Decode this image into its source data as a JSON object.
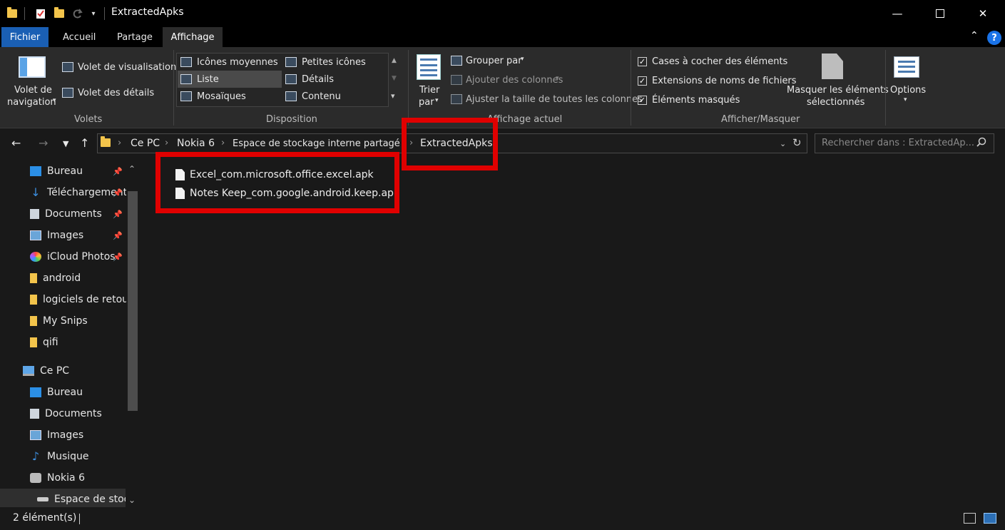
{
  "window": {
    "title": "ExtractedApks"
  },
  "tabs": [
    {
      "label": "Fichier"
    },
    {
      "label": "Accueil"
    },
    {
      "label": "Partage"
    },
    {
      "label": "Affichage"
    }
  ],
  "ribbon": {
    "panes": {
      "nav_pane_label_1": "Volet de",
      "nav_pane_label_2": "navigation",
      "preview_pane": "Volet de visualisation",
      "details_pane": "Volet des détails",
      "group_label": "Volets"
    },
    "layout": {
      "items": [
        "Icônes moyennes",
        "Petites icônes",
        "Liste",
        "Détails",
        "Mosaïques",
        "Contenu"
      ],
      "group_label": "Disposition"
    },
    "current_view": {
      "sort_label_1": "Trier",
      "sort_label_2": "par",
      "group_by": "Grouper par",
      "add_columns": "Ajouter des colonnes",
      "size_columns": "Ajuster la taille de toutes les colonnes",
      "group_label": "Affichage actuel"
    },
    "show_hide": {
      "item_checkboxes": "Cases à cocher des éléments",
      "file_extensions": "Extensions de noms de fichiers",
      "hidden_items": "Éléments masqués",
      "hide_selected_1": "Masquer les éléments",
      "hide_selected_2": "sélectionnés",
      "group_label": "Afficher/Masquer"
    },
    "options": "Options"
  },
  "address": {
    "crumbs": [
      "Ce PC",
      "Nokia 6",
      "Espace de stockage interne partagé",
      "ExtractedApks"
    ],
    "search_placeholder": "Rechercher dans : ExtractedAp..."
  },
  "nav_pane": {
    "quick_access": [
      {
        "label": "Bureau",
        "pinned": true
      },
      {
        "label": "Téléchargements",
        "pinned": true
      },
      {
        "label": "Documents",
        "pinned": true
      },
      {
        "label": "Images",
        "pinned": true
      },
      {
        "label": "iCloud Photos",
        "pinned": true
      },
      {
        "label": "android"
      },
      {
        "label": "logiciels de retou"
      },
      {
        "label": "My Snips"
      },
      {
        "label": "qifi"
      }
    ],
    "this_pc": "Ce PC",
    "pc_items": [
      {
        "label": "Bureau"
      },
      {
        "label": "Documents"
      },
      {
        "label": "Images"
      },
      {
        "label": "Musique"
      },
      {
        "label": "Nokia 6"
      },
      {
        "label": "Espace de stoc"
      }
    ]
  },
  "files": [
    {
      "name": "Excel_com.microsoft.office.excel.apk"
    },
    {
      "name": "Notes Keep_com.google.android.keep.apk"
    }
  ],
  "status": {
    "count": "2 élément(s)"
  },
  "colors": {
    "accent": "#1a5fb4",
    "highlight": "#e00000",
    "folder": "#f3c44b"
  }
}
